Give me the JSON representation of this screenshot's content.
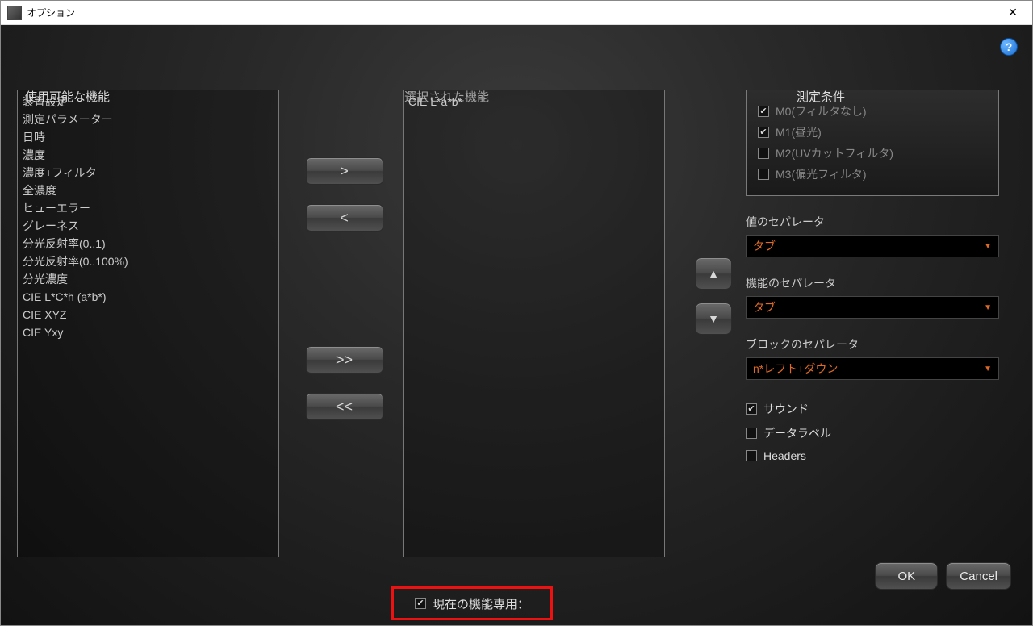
{
  "window": {
    "title": "オプション"
  },
  "labels": {
    "available": "使用可能な機能",
    "selected": "選択された機能",
    "conditions": "測定条件",
    "value_sep": "値のセパレータ",
    "func_sep": "機能のセパレータ",
    "block_sep": "ブロックのセパレータ",
    "current_only": "現在の機能専用："
  },
  "available_items": [
    "装置設定",
    "測定パラメーター",
    "日時",
    "濃度",
    "濃度+フィルタ",
    "全濃度",
    "ヒューエラー",
    "グレーネス",
    "分光反射率(0..1)",
    "分光反射率(0..100%)",
    "分光濃度",
    "CIE L*C*h (a*b*)",
    "CIE XYZ",
    "CIE Yxy"
  ],
  "selected_items": [
    "CIE L*a*b*"
  ],
  "conditions_list": [
    {
      "label": "M0(フィルタなし)",
      "checked": true,
      "enabled": false
    },
    {
      "label": "M1(昼光)",
      "checked": true,
      "enabled": false
    },
    {
      "label": "M2(UVカットフィルタ)",
      "checked": false,
      "enabled": false
    },
    {
      "label": "M3(偏光フィルタ)",
      "checked": false,
      "enabled": false
    }
  ],
  "separators": {
    "value": "タブ",
    "func": "タブ",
    "block": "n*レフト+ダウン"
  },
  "options": {
    "sound": {
      "label": "サウンド",
      "checked": true
    },
    "dlabel": {
      "label": "データラベル",
      "checked": false
    },
    "headers": {
      "label": "Headers",
      "checked": false
    }
  },
  "current_only_checked": true,
  "buttons": {
    "ok": "OK",
    "cancel": "Cancel"
  },
  "move": {
    "r": ">",
    "l": "<",
    "rr": ">>",
    "ll": "<<"
  }
}
